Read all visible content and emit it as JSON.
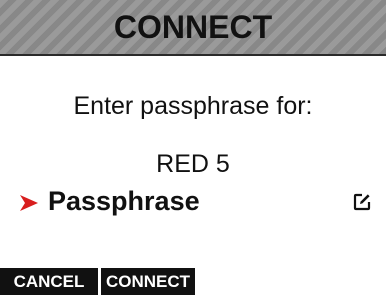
{
  "header": {
    "title": "CONNECT"
  },
  "body": {
    "prompt": "Enter passphrase for:",
    "network_name": "RED 5",
    "field": {
      "label": "Passphrase",
      "arrow_icon": "selection-arrow-icon",
      "edit_icon": "edit-icon"
    }
  },
  "footer": {
    "cancel_label": "CANCEL",
    "connect_label": "CONNECT"
  },
  "colors": {
    "accent_arrow": "#d81e1e",
    "softkey_bg": "#111111",
    "softkey_text": "#ffffff",
    "header_stripe_light": "#9a9a9a",
    "header_stripe_dark": "#888888"
  }
}
